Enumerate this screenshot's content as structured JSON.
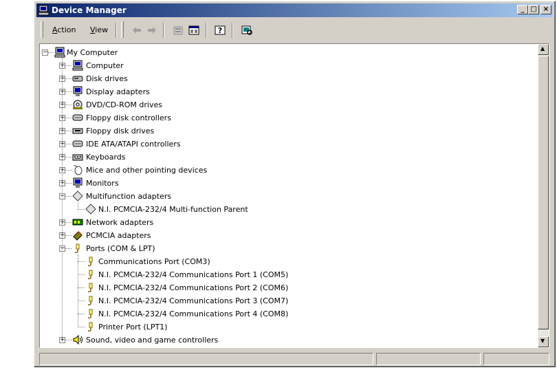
{
  "window": {
    "title": "Device Manager"
  },
  "caption_buttons": {
    "minimize": "_",
    "maximize": "□",
    "close": "×"
  },
  "menu": {
    "action": {
      "accel": "A",
      "rest": "ction"
    },
    "view": {
      "accel": "V",
      "rest": "iew"
    }
  },
  "toolbar_icons": [
    "back-arrow-icon",
    "forward-arrow-icon",
    "properties-icon",
    "view-toggle-icon",
    "help-icon",
    "scan-hardware-icon"
  ],
  "tree": {
    "root": "My Computer",
    "categories": [
      {
        "label": "Computer",
        "icon": "computer-icon",
        "expanded": false
      },
      {
        "label": "Disk drives",
        "icon": "disk-drive-icon",
        "expanded": false
      },
      {
        "label": "Display adapters",
        "icon": "display-adapter-icon",
        "expanded": false
      },
      {
        "label": "DVD/CD-ROM drives",
        "icon": "cdrom-icon",
        "expanded": false
      },
      {
        "label": "Floppy disk controllers",
        "icon": "controller-icon",
        "expanded": false
      },
      {
        "label": "Floppy disk drives",
        "icon": "floppy-icon",
        "expanded": false
      },
      {
        "label": "IDE ATA/ATAPI controllers",
        "icon": "controller-icon",
        "expanded": false
      },
      {
        "label": "Keyboards",
        "icon": "keyboard-icon",
        "expanded": false
      },
      {
        "label": "Mice and other pointing devices",
        "icon": "mouse-icon",
        "expanded": false
      },
      {
        "label": "Monitors",
        "icon": "monitor-icon",
        "expanded": false
      },
      {
        "label": "Multifunction adapters",
        "icon": "multifunction-icon",
        "expanded": true,
        "children": [
          "N.I. PCMCIA-232/4 Multi-function Parent"
        ]
      },
      {
        "label": "Network adapters",
        "icon": "network-icon",
        "expanded": false
      },
      {
        "label": "PCMCIA adapters",
        "icon": "pcmcia-icon",
        "expanded": false
      },
      {
        "label": "Ports (COM & LPT)",
        "icon": "port-icon",
        "expanded": true,
        "children": [
          "Communications Port (COM3)",
          "N.I. PCMCIA-232/4 Communications Port 1 (COM5)",
          "N.I. PCMCIA-232/4 Communications Port 2 (COM6)",
          "N.I. PCMCIA-232/4 Communications Port 3 (COM7)",
          "N.I. PCMCIA-232/4 Communications Port 4 (COM8)",
          "Printer Port (LPT1)"
        ]
      },
      {
        "label": "Sound, video and game controllers",
        "icon": "sound-icon",
        "expanded": false
      }
    ]
  },
  "scrollbar": {
    "up": "▲",
    "down": "▼"
  },
  "colors": {
    "titlebar_start": "#0a246a",
    "titlebar_end": "#a6caf0",
    "face": "#d4d0c8"
  }
}
